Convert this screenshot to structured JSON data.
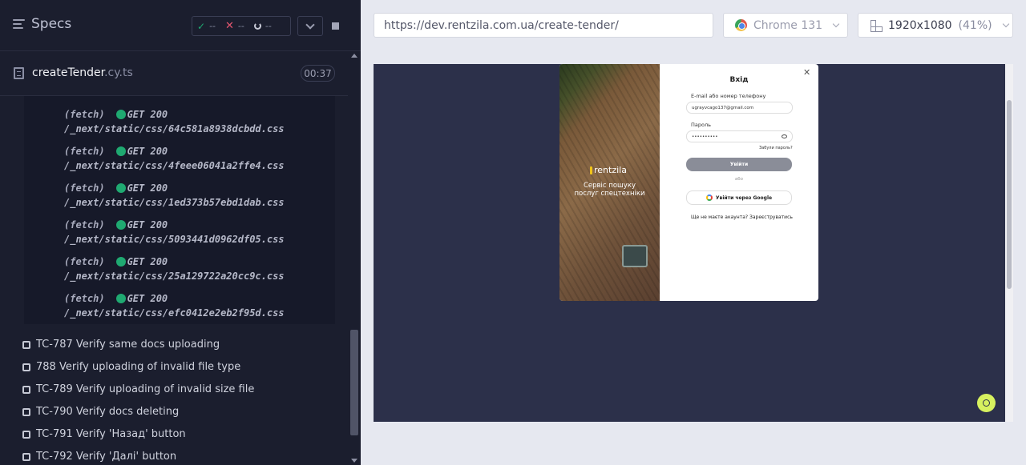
{
  "sidebar": {
    "title": "Specs",
    "stats": {
      "passed": "--",
      "failed": "--",
      "pending": "--"
    },
    "file": {
      "name": "createTender",
      "ext": ".cy.ts",
      "duration": "00:37"
    },
    "commands": [
      {
        "prefix": "(fetch)",
        "method": "GET 200",
        "path": "/_next/static/css/64c581a8938dcbdd.css"
      },
      {
        "prefix": "(fetch)",
        "method": "GET 200",
        "path": "/_next/static/css/4feee06041a2ffe4.css"
      },
      {
        "prefix": "(fetch)",
        "method": "GET 200",
        "path": "/_next/static/css/1ed373b57ebd1dab.css"
      },
      {
        "prefix": "(fetch)",
        "method": "GET 200",
        "path": "/_next/static/css/5093441d0962df05.css"
      },
      {
        "prefix": "(fetch)",
        "method": "GET 200",
        "path": "/_next/static/css/25a129722a20cc9c.css"
      },
      {
        "prefix": "(fetch)",
        "method": "GET 200",
        "path": "/_next/static/css/efc0412e2eb2f95d.css"
      }
    ],
    "tests": [
      "TC-787 Verify same docs uploading",
      "788 Verify uploading of invalid file type",
      "TC-789 Verify uploading of invalid size file",
      "TC-790 Verify docs deleting",
      "TC-791 Verify 'Назад' button",
      "TC-792 Verify 'Далі' button"
    ]
  },
  "header": {
    "url": "https://dev.rentzila.com.ua/create-tender/",
    "browser": "Chrome 131",
    "viewport": "1920x1080",
    "zoom": "(41%)"
  },
  "app": {
    "logo": "rentzila",
    "tagline1": "Сервіс пошуку",
    "tagline2": "послуг спецтехніки",
    "modal_title": "Вхід",
    "email_label": "E-mail або номер телефону",
    "email_value": "ugrayvcago137@gmail.com",
    "password_label": "Пароль",
    "password_value": "••••••••••",
    "forgot": "Забули пароль?",
    "login": "Увійти",
    "or": "або",
    "google": "Увійти через Google",
    "register": "Ще не маєте акаунта? Зареєструватись"
  },
  "colors": {
    "pass": "#1fa971",
    "fail": "#e45770",
    "chat": "#d7f15f"
  }
}
